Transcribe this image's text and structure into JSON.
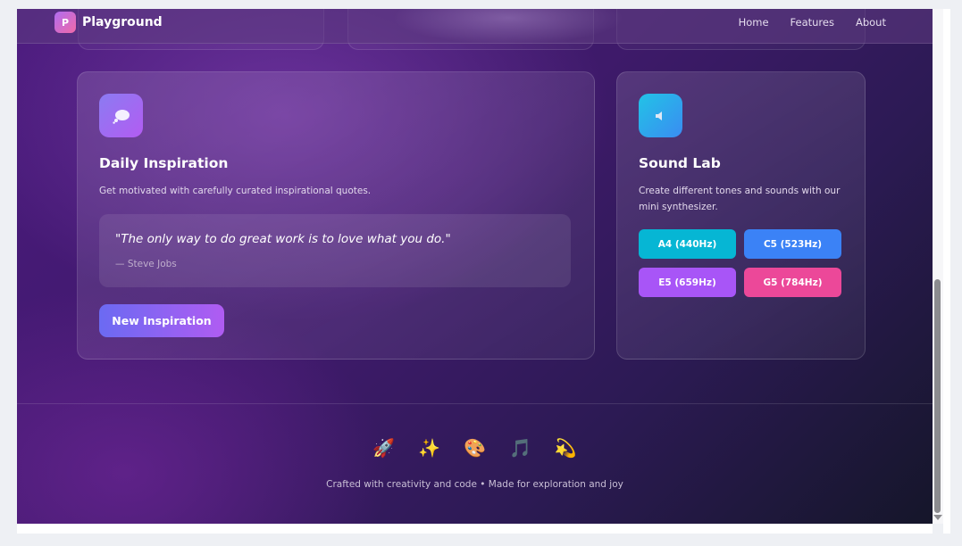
{
  "nav": {
    "logo_letter": "P",
    "brand": "Playground",
    "links": [
      "Home",
      "Features",
      "About"
    ]
  },
  "cards": {
    "inspiration": {
      "icon": "thought-bubble-icon",
      "title": "Daily Inspiration",
      "description": "Get motivated with carefully curated inspirational quotes.",
      "quote": "\"The only way to do great work is to love what you do.\"",
      "author": "— Steve Jobs",
      "button": "New Inspiration"
    },
    "sound": {
      "icon": "speaker-icon",
      "title": "Sound Lab",
      "description_line1": "Create different tones and sounds with our",
      "description_line2": "mini synthesizer.",
      "notes": [
        {
          "label": "A4 (440Hz)",
          "color": "#06b6d4"
        },
        {
          "label": "C5 (523Hz)",
          "color": "#3b82f6"
        },
        {
          "label": "E5 (659Hz)",
          "color": "#a855f7"
        },
        {
          "label": "G5 (784Hz)",
          "color": "#ec4899"
        }
      ]
    }
  },
  "footer": {
    "emojis": [
      "🚀",
      "✨",
      "🎨",
      "🎵",
      "💫"
    ],
    "text": "Crafted with creativity and code • Made for exploration and joy"
  }
}
